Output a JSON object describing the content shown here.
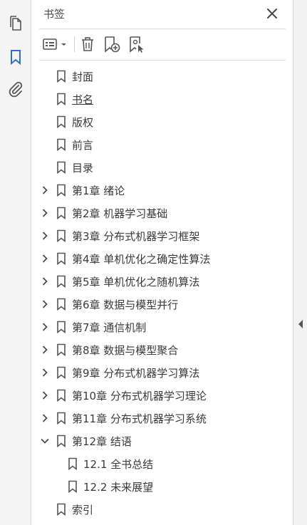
{
  "colors": {
    "accent": "#2d6fd6",
    "icon": "#555555",
    "text": "#3a3a3a"
  },
  "rail": {
    "items": [
      {
        "name": "pages-icon",
        "active": false
      },
      {
        "name": "bookmark-icon",
        "active": true
      },
      {
        "name": "attachment-icon",
        "active": false
      }
    ]
  },
  "panel": {
    "title": "书签",
    "close_icon": "close-icon"
  },
  "toolbar": {
    "options_icon": "list-options-icon",
    "delete_icon": "trash-icon",
    "new_bookmark_icon": "new-bookmark-icon",
    "bookmark_from_selection_icon": "bookmark-selection-icon"
  },
  "bookmarks": [
    {
      "label": "封面",
      "level": 0,
      "twisty": "none"
    },
    {
      "label": "书名",
      "level": 0,
      "twisty": "none",
      "underlined": true
    },
    {
      "label": "版权",
      "level": 0,
      "twisty": "none"
    },
    {
      "label": "前言",
      "level": 0,
      "twisty": "none"
    },
    {
      "label": "目录",
      "level": 0,
      "twisty": "none"
    },
    {
      "label": "第1章  绪论",
      "level": 0,
      "twisty": "collapsed"
    },
    {
      "label": "第2章  机器学习基础",
      "level": 0,
      "twisty": "collapsed"
    },
    {
      "label": "第3章  分布式机器学习框架",
      "level": 0,
      "twisty": "collapsed"
    },
    {
      "label": "第4章  单机优化之确定性算法",
      "level": 0,
      "twisty": "collapsed"
    },
    {
      "label": "第5章  单机优化之随机算法",
      "level": 0,
      "twisty": "collapsed"
    },
    {
      "label": "第6章  数据与模型并行",
      "level": 0,
      "twisty": "collapsed"
    },
    {
      "label": "第7章  通信机制",
      "level": 0,
      "twisty": "collapsed"
    },
    {
      "label": "第8章  数据与模型聚合",
      "level": 0,
      "twisty": "collapsed"
    },
    {
      "label": "第9章  分布式机器学习算法",
      "level": 0,
      "twisty": "collapsed"
    },
    {
      "label": "第10章  分布式机器学习理论",
      "level": 0,
      "twisty": "collapsed"
    },
    {
      "label": "第11章  分布式机器学习系统",
      "level": 0,
      "twisty": "collapsed"
    },
    {
      "label": "第12章  结语",
      "level": 0,
      "twisty": "expanded"
    },
    {
      "label": "12.1  全书总结",
      "level": 1,
      "twisty": "none"
    },
    {
      "label": "12.2  未来展望",
      "level": 1,
      "twisty": "none"
    },
    {
      "label": "索引",
      "level": 0,
      "twisty": "none"
    }
  ],
  "right_strip": {
    "collapse_icon": "collapse-left-arrow-icon"
  }
}
